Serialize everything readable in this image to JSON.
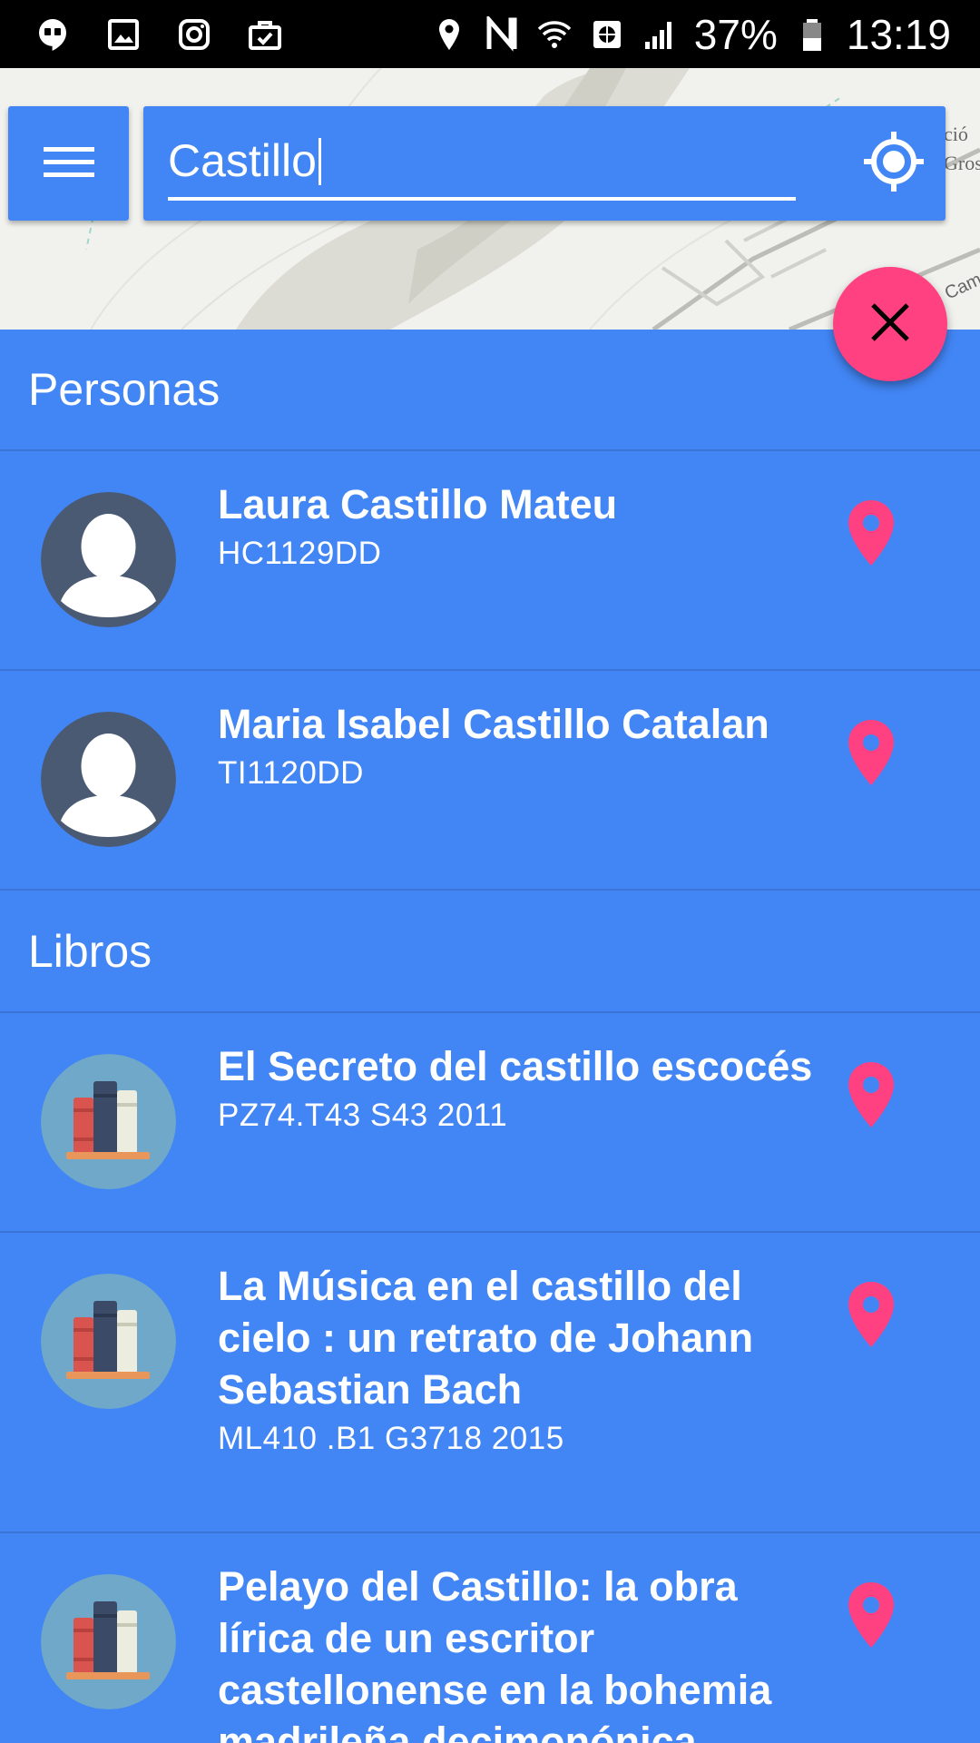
{
  "status_bar": {
    "battery_percent": "37%",
    "time": "13:19",
    "left_icons": [
      "hangouts-icon",
      "gallery-icon",
      "instagram-icon",
      "briefcase-icon"
    ],
    "right_icons": [
      "location-icon",
      "nfc-icon",
      "wifi-icon",
      "data-saver-icon",
      "signal-icon",
      "battery-icon"
    ]
  },
  "search": {
    "value": "Castillo",
    "menu_icon": "hamburger-menu-icon",
    "locate_icon": "my-location-icon"
  },
  "fab": {
    "icon": "close-icon",
    "color": "#ff4081"
  },
  "map": {
    "labels": [
      "ció",
      "Gros",
      "Cam"
    ]
  },
  "sections": [
    {
      "title": "Personas",
      "items": [
        {
          "title": "Laura Castillo Mateu",
          "subtitle": "HC1129DD",
          "avatar": "person-avatar-icon"
        },
        {
          "title": "Maria Isabel Castillo Catalan",
          "subtitle": "TI1120DD",
          "avatar": "person-avatar-icon"
        }
      ]
    },
    {
      "title": "Libros",
      "items": [
        {
          "title": "El Secreto del castillo escocés",
          "subtitle": "PZ74.T43 S43 2011",
          "avatar": "books-icon"
        },
        {
          "title": "La Música en el castillo del cielo : un retrato de Johann Sebastian Bach",
          "subtitle": "ML410 .B1 G3718 2015",
          "avatar": "books-icon"
        },
        {
          "title": "Pelayo del Castillo: la obra lírica de un escritor castellonense en la bohemia madrileña decimonónica",
          "subtitle": "",
          "avatar": "books-icon"
        }
      ]
    }
  ],
  "colors": {
    "primary": "#4285f4",
    "accent": "#ff4081",
    "pin": "#ff4081"
  }
}
